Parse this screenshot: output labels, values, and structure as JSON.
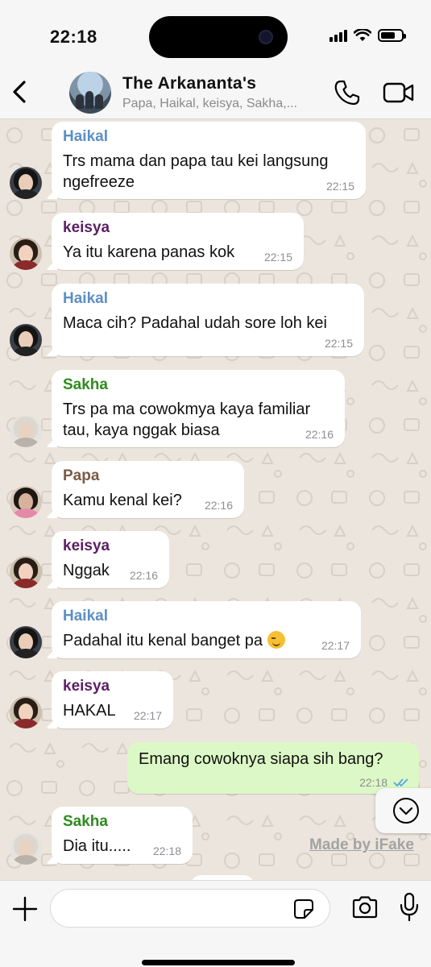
{
  "status_bar": {
    "time": "22:18",
    "battery_level": 0.7
  },
  "header": {
    "title": "The Arkananta's",
    "subtitle": "Papa, Haikal, keisya, Sakha,...",
    "icons": {
      "back": "chevron-left-icon",
      "call": "phone-icon",
      "video": "video-camera-icon"
    }
  },
  "colors": {
    "haikal": "#5b8fc4",
    "keisya": "#5a1f63",
    "sakha": "#2e8b1e",
    "papa": "#7a5b44",
    "outgoing_bubble": "#dcf8c6",
    "read_ticks": "#53a6e6"
  },
  "messages": [
    {
      "sender": "Haikal",
      "lines": [
        "Trs mama dan papa tau kei langsung",
        "ngefreeze"
      ],
      "time": "22:15"
    },
    {
      "sender": "keisya",
      "lines": [
        "Ya itu karena panas kok"
      ],
      "time": "22:15"
    },
    {
      "sender": "Haikal",
      "lines": [
        "Maca cih? Padahal udah sore loh kei"
      ],
      "time": "22:15"
    },
    {
      "sender": "Sakha",
      "lines": [
        "Trs pa ma cowokmya kaya familiar",
        "tau, kaya nggak biasa"
      ],
      "time": "22:16"
    },
    {
      "sender": "Papa",
      "lines": [
        "Kamu kenal kei?"
      ],
      "time": "22:16"
    },
    {
      "sender": "keisya",
      "lines": [
        "Nggak"
      ],
      "time": "22:16"
    },
    {
      "sender": "Haikal",
      "lines": [
        "Padahal itu kenal banget pa"
      ],
      "emoji": "smirking-face-icon",
      "time": "22:17"
    },
    {
      "sender": "keisya",
      "lines": [
        "HAKAL"
      ],
      "time": "22:17"
    },
    {
      "sender": "",
      "lines": [
        "Emang cowoknya siapa sih bang?"
      ],
      "time": "22:18",
      "outgoing": true,
      "status_icon": "double-check-icon"
    },
    {
      "sender": "Sakha",
      "lines": [
        "Dia itu....."
      ],
      "time": "22:18"
    }
  ],
  "overlay": {
    "scroll_icon": "chevron-down-circle-icon",
    "watermark": "Made by iFake"
  },
  "input_bar": {
    "placeholder": "",
    "icons": {
      "plus": "plus-icon",
      "sticker": "sticker-icon",
      "camera": "camera-icon",
      "mic": "microphone-icon"
    }
  }
}
